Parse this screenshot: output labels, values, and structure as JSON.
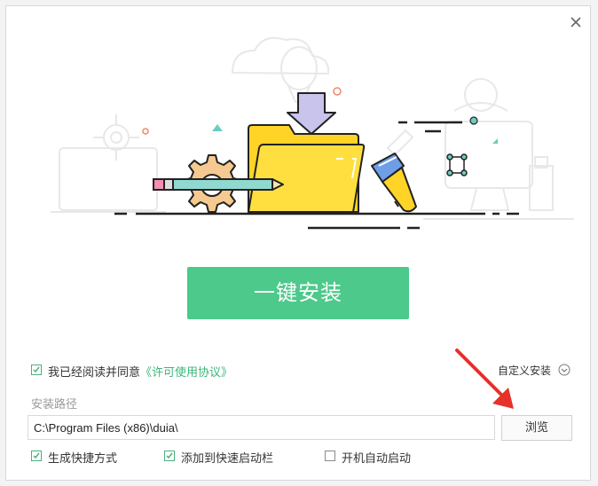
{
  "install": {
    "button_label": "一键安装"
  },
  "agreement": {
    "checked": true,
    "prefix": "我已经阅读并同意",
    "link": "《许可使用协议》"
  },
  "custom_install": {
    "label": "自定义安装"
  },
  "install_path": {
    "label": "安装路径",
    "value": "C:\\Program Files (x86)\\duia\\",
    "browse_label": "浏览"
  },
  "options": [
    {
      "label": "生成快捷方式",
      "checked": true
    },
    {
      "label": "添加到快速启动栏",
      "checked": true
    },
    {
      "label": "开机自动启动",
      "checked": false
    }
  ],
  "colors": {
    "accent": "#4cc98b",
    "link": "#3db67a",
    "folder": "#ffd426",
    "arrow": "#c8c4e8",
    "annotation_arrow": "#e8302a"
  },
  "icons": [
    "close-icon",
    "chevron-down-icon",
    "checkmark-icon",
    "folder-icon",
    "pencil-icon",
    "gear-icon",
    "paintbrush-icon",
    "download-arrow-icon"
  ]
}
